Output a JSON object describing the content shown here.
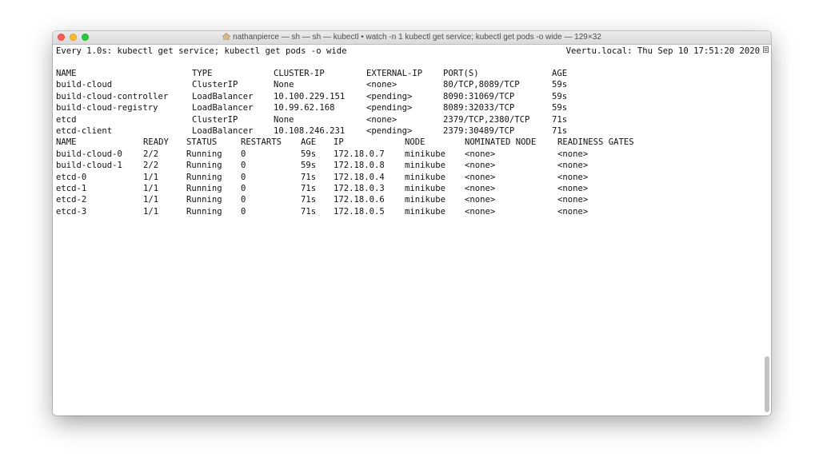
{
  "window": {
    "title": "nathanpierce — sh — sh — kubectl • watch -n 1 kubectl get service; kubectl get pods -o wide — 129×32"
  },
  "terminal": {
    "header_left": "Every 1.0s: kubectl get service; kubectl get pods -o wide",
    "header_right": "Veertu.local: Thu Sep 10 17:51:20 2020",
    "services": {
      "headers": [
        "NAME",
        "TYPE",
        "CLUSTER-IP",
        "EXTERNAL-IP",
        "PORT(S)",
        "AGE"
      ],
      "rows": [
        [
          "build-cloud",
          "ClusterIP",
          "None",
          "<none>",
          "80/TCP,8089/TCP",
          "59s"
        ],
        [
          "build-cloud-controller",
          "LoadBalancer",
          "10.100.229.151",
          "<pending>",
          "8090:31069/TCP",
          "59s"
        ],
        [
          "build-cloud-registry",
          "LoadBalancer",
          "10.99.62.168",
          "<pending>",
          "8089:32033/TCP",
          "59s"
        ],
        [
          "etcd",
          "ClusterIP",
          "None",
          "<none>",
          "2379/TCP,2380/TCP",
          "71s"
        ],
        [
          "etcd-client",
          "LoadBalancer",
          "10.108.246.231",
          "<pending>",
          "2379:30489/TCP",
          "71s"
        ]
      ]
    },
    "pods": {
      "headers": [
        "NAME",
        "READY",
        "STATUS",
        "RESTARTS",
        "AGE",
        "IP",
        "NODE",
        "NOMINATED NODE",
        "READINESS GATES"
      ],
      "rows": [
        [
          "build-cloud-0",
          "2/2",
          "Running",
          "0",
          "59s",
          "172.18.0.7",
          "minikube",
          "<none>",
          "<none>"
        ],
        [
          "build-cloud-1",
          "2/2",
          "Running",
          "0",
          "59s",
          "172.18.0.8",
          "minikube",
          "<none>",
          "<none>"
        ],
        [
          "etcd-0",
          "1/1",
          "Running",
          "0",
          "71s",
          "172.18.0.4",
          "minikube",
          "<none>",
          "<none>"
        ],
        [
          "etcd-1",
          "1/1",
          "Running",
          "0",
          "71s",
          "172.18.0.3",
          "minikube",
          "<none>",
          "<none>"
        ],
        [
          "etcd-2",
          "1/1",
          "Running",
          "0",
          "71s",
          "172.18.0.6",
          "minikube",
          "<none>",
          "<none>"
        ],
        [
          "etcd-3",
          "1/1",
          "Running",
          "0",
          "71s",
          "172.18.0.5",
          "minikube",
          "<none>",
          "<none>"
        ]
      ]
    }
  },
  "colors": {
    "close": "#fd5f57",
    "minimize": "#febc2e",
    "maximize": "#28c840",
    "text": "#111111"
  }
}
